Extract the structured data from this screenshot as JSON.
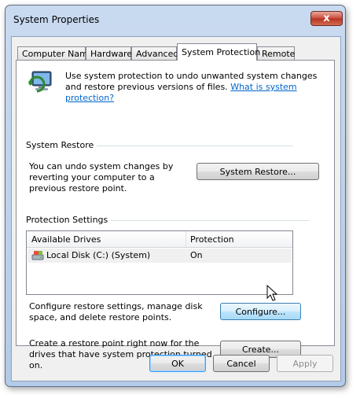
{
  "window": {
    "title": "System Properties",
    "close_glyph": "x"
  },
  "tabs": [
    {
      "label": "Computer Name",
      "active": false
    },
    {
      "label": "Hardware",
      "active": false
    },
    {
      "label": "Advanced",
      "active": false
    },
    {
      "label": "System Protection",
      "active": true
    },
    {
      "label": "Remote",
      "active": false
    }
  ],
  "intro": {
    "icon": "system-protection-icon",
    "text": "Use system protection to undo unwanted system changes and restore previous versions of files.",
    "link": "What is system protection?"
  },
  "system_restore": {
    "heading": "System Restore",
    "description": "You can undo system changes by reverting your computer to a previous restore point.",
    "button": "System Restore..."
  },
  "protection_settings": {
    "heading": "Protection Settings",
    "columns": [
      "Available Drives",
      "Protection"
    ],
    "rows": [
      {
        "icon": "local-disk-icon",
        "drive": "Local Disk (C:) (System)",
        "protection": "On"
      }
    ],
    "configure_text": "Configure restore settings, manage disk space, and delete restore points.",
    "configure_button": "Configure...",
    "create_text": "Create a restore point right now for the drives that have system protection turned on.",
    "create_button": "Create..."
  },
  "footer": {
    "ok": "OK",
    "cancel": "Cancel",
    "apply": "Apply"
  }
}
